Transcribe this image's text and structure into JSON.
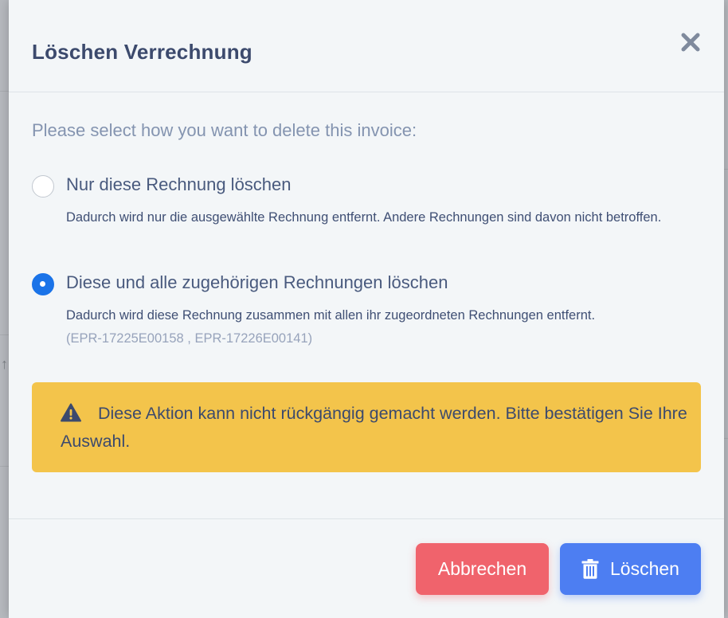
{
  "dialog": {
    "title": "Löschen Verrechnung",
    "close_icon": "close-icon"
  },
  "body": {
    "prompt": "Please select how you want to delete this invoice:",
    "options": [
      {
        "label": "Nur diese Rechnung löschen",
        "description": "Dadurch wird nur die ausgewählte Rechnung entfernt. Andere Rechnungen sind davon nicht betroffen.",
        "selected": false
      },
      {
        "label": "Diese und alle zugehörigen Rechnungen löschen",
        "description": "Dadurch wird diese Rechnung zusammen mit allen ihr zugeordneten Rechnungen entfernt.",
        "related_ids": "(EPR-17225E00158 , EPR-17226E00141)",
        "selected": true
      }
    ],
    "warning": {
      "icon": "warning-icon",
      "text": "Diese Aktion kann nicht rückgängig gemacht werden. Bitte bestätigen Sie Ihre Auswahl."
    }
  },
  "footer": {
    "cancel_label": "Abbrechen",
    "delete_label": "Löschen",
    "delete_icon": "trash-icon"
  },
  "colors": {
    "accent": "#1a73e8",
    "cancel": "#f0636c",
    "delete": "#4d7ef2",
    "warning": "#f3c44b",
    "title": "#3c4a6d"
  }
}
